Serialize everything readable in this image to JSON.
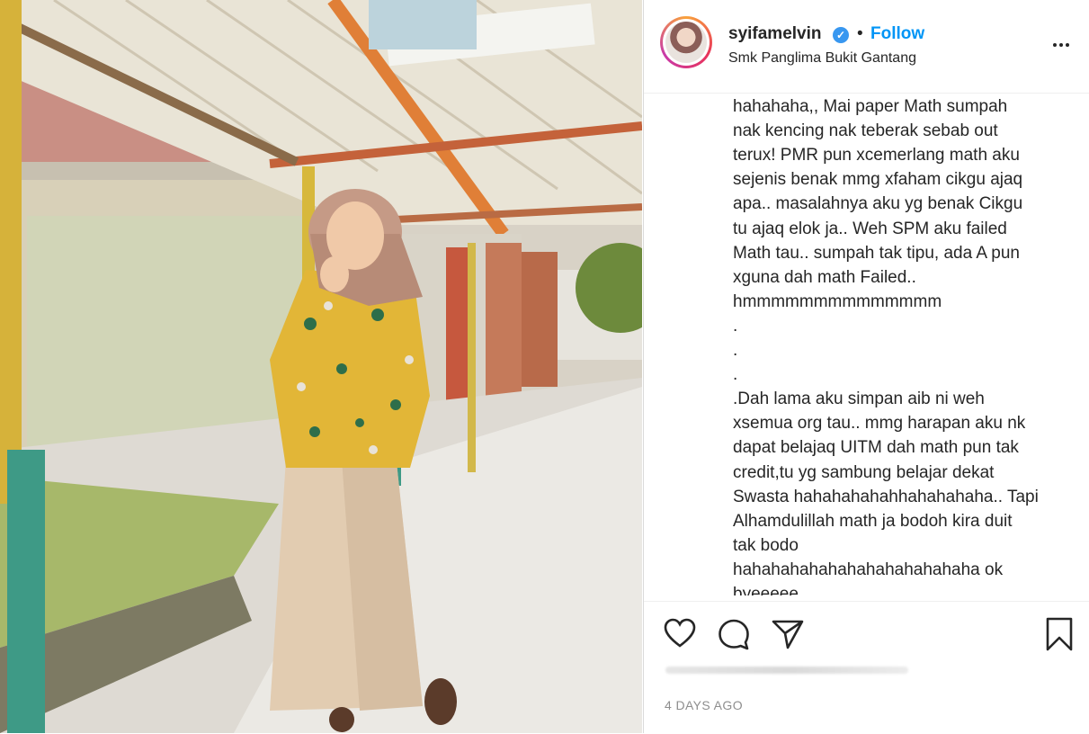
{
  "post": {
    "username": "syifamelvin",
    "verified_icon": "verified-badge-icon",
    "separator": "•",
    "follow_label": "Follow",
    "location": "Smk Panglima Bukit Gantang",
    "caption": "hahahaha,, Mai paper Math sumpah\nnak kencing nak teberak sebab out\nterux! PMR pun xcemerlang math aku\nsejenis benak mmg xfaham cikgu ajaq\napa.. masalahnya aku yg benak Cikgu\ntu ajaq elok ja.. Weh SPM aku failed\nMath tau.. sumpah tak tipu, ada A pun\nxguna dah math Failed..\nhmmmmmmmmmmmmmm\n.\n.\n.\n.Dah lama aku simpan aib ni weh\nxsemua org tau.. mmg harapan aku nk\ndapat belajaq UITM dah math pun tak\ncredit,tu yg sambung belajar dekat\nSwasta hahahahahahhahahahaha.. Tapi\nAlhamdulillah math ja bodoh kira duit\ntak bodo\nhahahahahahahahahahahahaha ok\nbyeeeee",
    "date": "4 DAYS AGO"
  },
  "icons": {
    "like": "heart-icon",
    "comment": "comment-bubble-icon",
    "share": "paper-plane-icon",
    "save": "bookmark-icon",
    "more": "more-options-icon"
  },
  "colors": {
    "follow": "#0095f6",
    "text": "#262626",
    "secondary": "#8e8e8e",
    "verified": "#3897f0"
  }
}
